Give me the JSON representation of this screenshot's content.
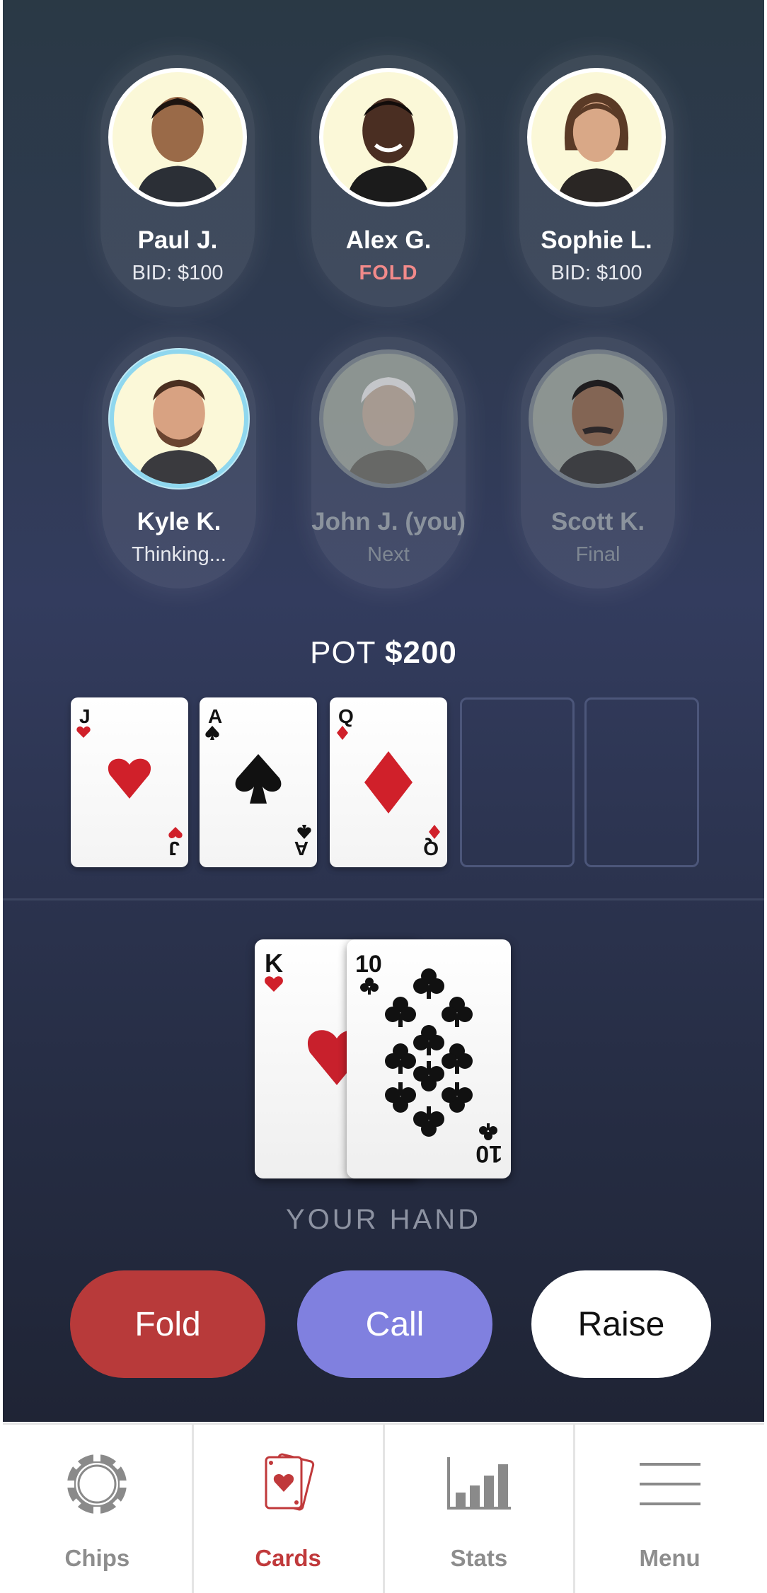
{
  "players": [
    {
      "name": "Paul J.",
      "status": "BID: $100",
      "state": "normal",
      "avatar": "portrait-young-man"
    },
    {
      "name": "Alex G.",
      "status": "FOLD",
      "state": "fold",
      "avatar": "portrait-man-smiling"
    },
    {
      "name": "Sophie L.",
      "status": "BID: $100",
      "state": "normal",
      "avatar": "portrait-woman"
    },
    {
      "name": "Kyle K.",
      "status": "Thinking...",
      "state": "active",
      "avatar": "portrait-man-beard"
    },
    {
      "name": "John J. (you)",
      "status": "Next",
      "state": "dimmed",
      "avatar": "portrait-older-man"
    },
    {
      "name": "Scott K.",
      "status": "Final",
      "state": "dimmed",
      "avatar": "portrait-man-mustache"
    }
  ],
  "pot": {
    "label": "POT",
    "amount": "$200"
  },
  "community_cards": [
    {
      "rank": "J",
      "suit": "hearts"
    },
    {
      "rank": "A",
      "suit": "spades"
    },
    {
      "rank": "Q",
      "suit": "diamonds"
    }
  ],
  "empty_slots": 2,
  "hand": {
    "label": "YOUR HAND",
    "cards": [
      {
        "rank": "K",
        "suit": "hearts"
      },
      {
        "rank": "10",
        "suit": "clubs"
      }
    ]
  },
  "actions": {
    "fold": "Fold",
    "call": "Call",
    "raise": "Raise"
  },
  "nav": [
    {
      "label": "Chips",
      "icon": "chip-icon",
      "active": false
    },
    {
      "label": "Cards",
      "icon": "cards-icon",
      "active": true
    },
    {
      "label": "Stats",
      "icon": "bar-chart-icon",
      "active": false
    },
    {
      "label": "Menu",
      "icon": "hamburger-menu-icon",
      "active": false
    }
  ],
  "colors": {
    "fold": "#b83a3a",
    "call": "#8080df",
    "accent": "#c0393b",
    "red_suit": "#d0202a",
    "active_ring": "#8fd7ee"
  }
}
